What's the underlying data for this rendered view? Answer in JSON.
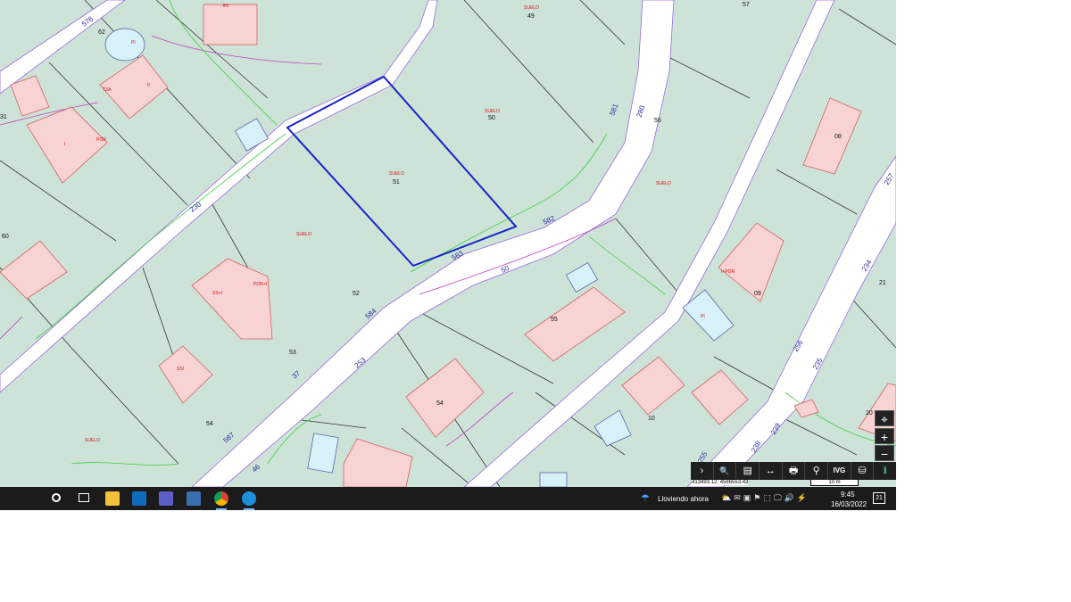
{
  "map": {
    "lot_labels": {
      "l49": "49",
      "l57": "57",
      "l62": "62",
      "l50": "50",
      "l56": "56",
      "l51": "51",
      "l60": "60",
      "l52": "52",
      "l53": "53",
      "l54a": "54",
      "l54b": "54",
      "l55": "55",
      "l08": "08",
      "l09": "09",
      "l10": "10",
      "l21": "21",
      "l20": "20",
      "l31": "31"
    },
    "zone_labels": {
      "suelo_49": "SUELO",
      "suelo_50": "SUELO",
      "suelo_51": "SUELO",
      "suelo_52": "SUELO",
      "suelo_56": "SUELO",
      "suelo_54": "SUELO"
    },
    "road_labels": {
      "r576": "576",
      "r581": "581",
      "r280": "280",
      "r582": "582",
      "r583": "583",
      "r584": "584",
      "r50": "50",
      "r37": "37",
      "r253": "253",
      "r587": "587",
      "r46": "46",
      "r257": "257",
      "r234": "234",
      "r256": "256",
      "r235": "235",
      "r239": "239",
      "r238": "238",
      "r255": "255",
      "r230": "230"
    },
    "building_labels": {
      "pi": "PI",
      "tza": "TZA",
      "por": "POR",
      "i": "I",
      "ii": "II",
      "sshi": "SS+I",
      "porpi": "POR+I",
      "ssi": "SSI",
      "miii": "-IHI",
      "ipor": "I+POR",
      "pi2": "PI"
    },
    "colors": {
      "land": "#cde3d8",
      "road": "#ffffff",
      "building_fill": "#f8d3d3",
      "building_stroke": "#d46060",
      "pool_fill": "#d7f1f8",
      "selected_parcel": "#1a22c8",
      "boundary": "#7a4fd6",
      "vegetation": "#3ed03e",
      "label_red": "#d10f0f",
      "label_blue": "#2a2aa0"
    }
  },
  "map_controls": {
    "locate_icon": "crosshair-icon",
    "zoom_in": "+",
    "zoom_out": "−",
    "toolbar": {
      "expand": "›",
      "search": "🔍",
      "layers": "▤",
      "measure": "↔",
      "print": "🖶",
      "ref": "⚲",
      "ivg": "IVG",
      "share": "⛁",
      "info": "ℹ"
    },
    "coordinates": "413493.12, 4586553.43",
    "scale_label": "10 m"
  },
  "taskbar": {
    "weather_text": "Lloviendo ahora",
    "time": "9:45",
    "date": "16/03/2022",
    "notification_count": "21"
  }
}
